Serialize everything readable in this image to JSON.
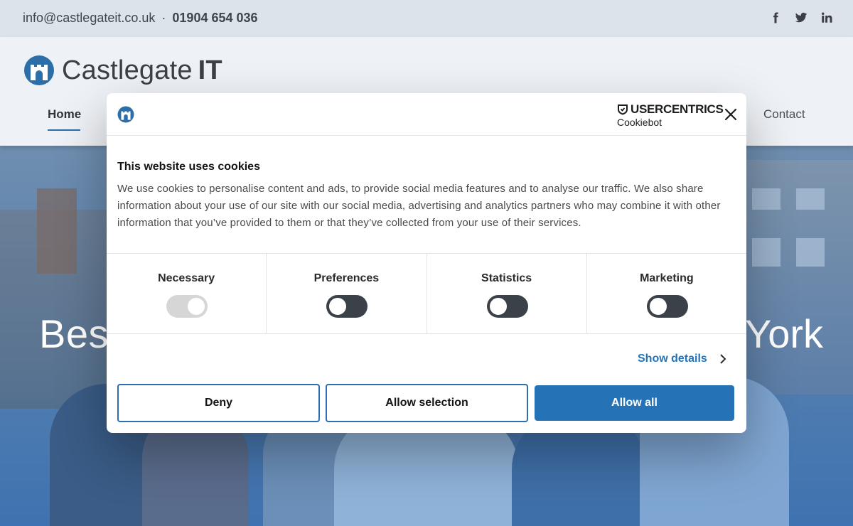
{
  "topbar": {
    "email": "info@castlegateit.co.uk",
    "separator": "·",
    "phone": "01904 654 036",
    "social_icons": [
      "facebook-icon",
      "twitter-icon",
      "linkedin-icon"
    ]
  },
  "header": {
    "brand_light": "Castlegate",
    "brand_bold": "IT",
    "nav": {
      "home": "Home",
      "contact": "Contact"
    }
  },
  "hero": {
    "headline_left": "Besp",
    "headline_right": "York"
  },
  "cookie_dialog": {
    "vendor_name": "USERCENTRICS",
    "vendor_product": "Cookiebot",
    "title": "This website uses cookies",
    "body": "We use cookies to personalise content and ads, to provide social media features and to analyse our traffic. We also share information about your use of our site with our social media, advertising and analytics partners who may combine it with other information that you’ve provided to them or that they’ve collected from your use of their services.",
    "categories": [
      {
        "label": "Necessary",
        "state": "on-disabled"
      },
      {
        "label": "Preferences",
        "state": "off"
      },
      {
        "label": "Statistics",
        "state": "off"
      },
      {
        "label": "Marketing",
        "state": "off"
      }
    ],
    "show_details": "Show details",
    "buttons": {
      "deny": "Deny",
      "allow_selection": "Allow selection",
      "allow_all": "Allow all"
    }
  },
  "colors": {
    "accent_blue": "#2672b7",
    "topbar_bg": "#dde3ea",
    "header_bg": "#eef1f5",
    "toggle_dark": "#3b4148"
  }
}
